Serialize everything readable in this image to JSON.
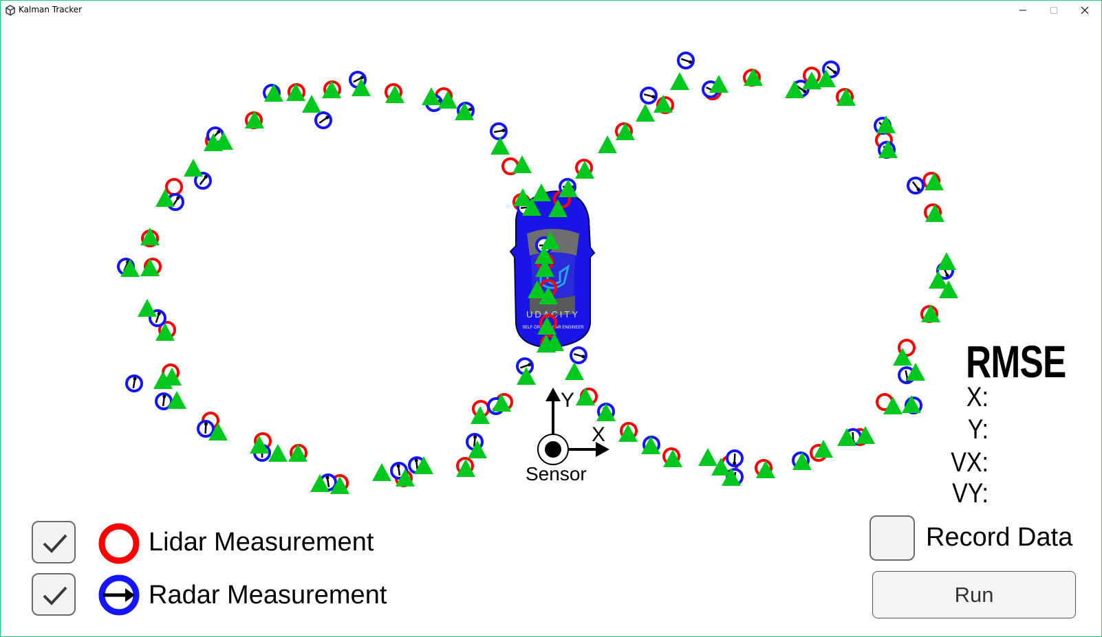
{
  "window": {
    "title": "Kalman Tracker",
    "app_icon": "unity-logo-icon",
    "controls": [
      "minimize",
      "maximize",
      "close"
    ],
    "border_color": "#1fc87a"
  },
  "scene": {
    "car": {
      "color": "#1a14e6",
      "brand_text": "UDACITY",
      "sub_text": "SELF-DRIVING CAR ENGINEER"
    },
    "sensor": {
      "label": "Sensor",
      "x_axis_label": "X",
      "y_axis_label": "Y"
    },
    "colors": {
      "lidar": "#ff0000",
      "radar": "#1414ff",
      "estimate": "#00c81e",
      "radar_arrow": "#000000"
    },
    "markers": {
      "lidar": [
        [
          431,
          134
        ],
        [
          483,
          130
        ],
        [
          572,
          134
        ],
        [
          645,
          140
        ],
        [
          311,
          205
        ],
        [
          369,
          175
        ],
        [
          253,
          272
        ],
        [
          218,
          347
        ],
        [
          222,
          388
        ],
        [
          243,
          480
        ],
        [
          248,
          542
        ],
        [
          306,
          612
        ],
        [
          382,
          642
        ],
        [
          434,
          659
        ],
        [
          494,
          703
        ],
        [
          587,
          696
        ],
        [
          699,
          595
        ],
        [
          733,
          585
        ],
        [
          676,
          678
        ],
        [
          742,
          242
        ],
        [
          758,
          294
        ],
        [
          817,
          290
        ],
        [
          849,
          244
        ],
        [
          907,
          191
        ],
        [
          967,
          153
        ],
        [
          1036,
          133
        ],
        [
          1093,
          113
        ],
        [
          1180,
          110
        ],
        [
          1228,
          141
        ],
        [
          1285,
          204
        ],
        [
          1354,
          263
        ],
        [
          1356,
          309
        ],
        [
          1351,
          457
        ],
        [
          1318,
          506
        ],
        [
          1286,
          585
        ],
        [
          1250,
          636
        ],
        [
          1190,
          659
        ],
        [
          1110,
          681
        ],
        [
          1061,
          675
        ],
        [
          976,
          664
        ],
        [
          914,
          627
        ],
        [
          856,
          577
        ],
        [
          792,
          381
        ],
        [
          797,
          419
        ],
        [
          797,
          470
        ],
        [
          798,
          500
        ]
      ],
      "radar": [
        [
          395,
          135
        ],
        [
          520,
          116
        ],
        [
          470,
          175
        ],
        [
          313,
          197
        ],
        [
          295,
          263
        ],
        [
          255,
          294
        ],
        [
          183,
          388
        ],
        [
          229,
          463
        ],
        [
          195,
          558
        ],
        [
          238,
          584
        ],
        [
          299,
          624
        ],
        [
          381,
          659
        ],
        [
          477,
          702
        ],
        [
          580,
          685
        ],
        [
          606,
          677
        ],
        [
          690,
          643
        ],
        [
          721,
          591
        ],
        [
          763,
          533
        ],
        [
          841,
          517
        ],
        [
          725,
          191
        ],
        [
          677,
          161
        ],
        [
          631,
          150
        ],
        [
          997,
          88
        ],
        [
          943,
          139
        ],
        [
          1033,
          130
        ],
        [
          1164,
          129
        ],
        [
          1208,
          101
        ],
        [
          1283,
          183
        ],
        [
          1289,
          218
        ],
        [
          1331,
          270
        ],
        [
          1374,
          394
        ],
        [
          1318,
          546
        ],
        [
          1328,
          590
        ],
        [
          1240,
          636
        ],
        [
          1164,
          670
        ],
        [
          1068,
          667
        ],
        [
          1068,
          694
        ],
        [
          947,
          647
        ],
        [
          881,
          599
        ],
        [
          825,
          272
        ],
        [
          764,
          302
        ],
        [
          791,
          357
        ]
      ],
      "estimate": [
        [
          398,
          136
        ],
        [
          430,
          135
        ],
        [
          482,
          131
        ],
        [
          525,
          128
        ],
        [
          574,
          138
        ],
        [
          627,
          141
        ],
        [
          651,
          146
        ],
        [
          675,
          163
        ],
        [
          453,
          152
        ],
        [
          370,
          175
        ],
        [
          310,
          208
        ],
        [
          325,
          206
        ],
        [
          281,
          245
        ],
        [
          240,
          289
        ],
        [
          218,
          345
        ],
        [
          189,
          391
        ],
        [
          218,
          390
        ],
        [
          214,
          449
        ],
        [
          240,
          484
        ],
        [
          237,
          554
        ],
        [
          250,
          549
        ],
        [
          257,
          583
        ],
        [
          317,
          629
        ],
        [
          377,
          648
        ],
        [
          404,
          660
        ],
        [
          433,
          660
        ],
        [
          465,
          704
        ],
        [
          494,
          707
        ],
        [
          555,
          688
        ],
        [
          589,
          696
        ],
        [
          616,
          678
        ],
        [
          677,
          682
        ],
        [
          698,
          605
        ],
        [
          694,
          655
        ],
        [
          729,
          587
        ],
        [
          765,
          548
        ],
        [
          835,
          541
        ],
        [
          851,
          578
        ],
        [
          881,
          601
        ],
        [
          913,
          631
        ],
        [
          946,
          649
        ],
        [
          978,
          668
        ],
        [
          1029,
          666
        ],
        [
          1048,
          680
        ],
        [
          1063,
          695
        ],
        [
          1113,
          684
        ],
        [
          1166,
          672
        ],
        [
          1197,
          654
        ],
        [
          1231,
          637
        ],
        [
          1258,
          634
        ],
        [
          1298,
          591
        ],
        [
          1325,
          589
        ],
        [
          1312,
          520
        ],
        [
          1331,
          542
        ],
        [
          1353,
          457
        ],
        [
          1376,
          381
        ],
        [
          1364,
          408
        ],
        [
          1379,
          422
        ],
        [
          1288,
          182
        ],
        [
          1291,
          218
        ],
        [
          1358,
          265
        ],
        [
          1359,
          311
        ],
        [
          727,
          213
        ],
        [
          759,
          240
        ],
        [
          787,
          281
        ],
        [
          811,
          304
        ],
        [
          826,
          275
        ],
        [
          850,
          248
        ],
        [
          883,
          211
        ],
        [
          909,
          192
        ],
        [
          938,
          165
        ],
        [
          988,
          119
        ],
        [
          964,
          152
        ],
        [
          1045,
          123
        ],
        [
          1095,
          113
        ],
        [
          1155,
          131
        ],
        [
          1180,
          118
        ],
        [
          1201,
          115
        ],
        [
          1230,
          142
        ],
        [
          760,
          288
        ],
        [
          773,
          302
        ],
        [
          800,
          351
        ],
        [
          791,
          372
        ],
        [
          792,
          391
        ],
        [
          781,
          422
        ],
        [
          797,
          431
        ],
        [
          795,
          475
        ],
        [
          794,
          501
        ],
        [
          806,
          499
        ]
      ]
    }
  },
  "rmse": {
    "title": "RMSE",
    "labels": [
      "X:",
      "Y:",
      "VX:",
      "VY:"
    ],
    "values": [
      "",
      "",
      "",
      ""
    ]
  },
  "legend": {
    "lidar": {
      "label": "Lidar Measurement",
      "checked": true,
      "icon": "lidar-ring-icon"
    },
    "radar": {
      "label": "Radar Measurement",
      "checked": true,
      "icon": "radar-ring-arrow-icon"
    }
  },
  "controls": {
    "record_data_label": "Record Data",
    "record_data_checked": false,
    "run_label": "Run"
  }
}
